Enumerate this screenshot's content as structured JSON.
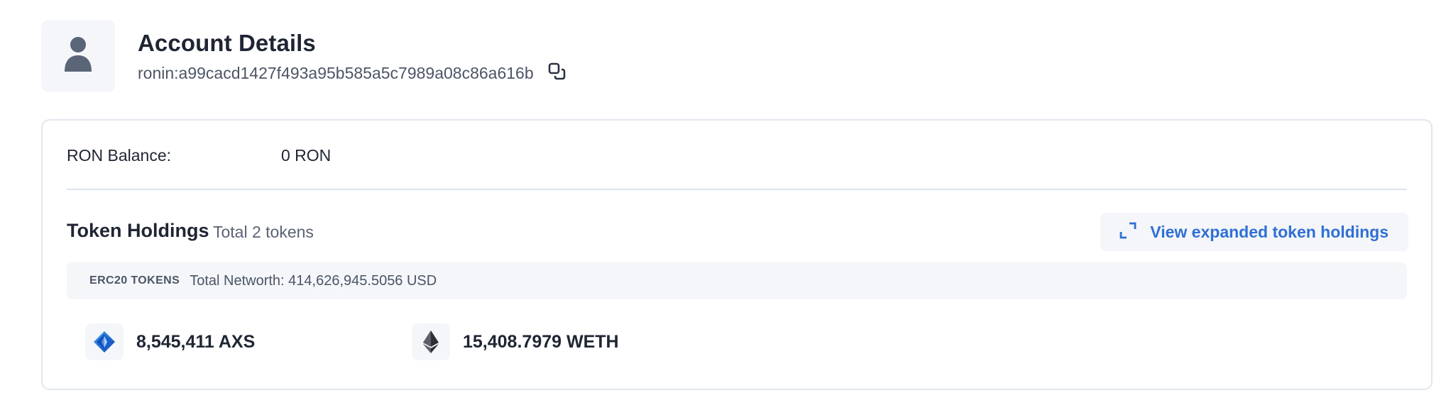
{
  "account": {
    "title": "Account Details",
    "address": "ronin:a99cacd1427f493a95b585a5c7989a08c86a616b",
    "avatar_icon": "user-icon",
    "copy_icon": "copy-icon"
  },
  "balance": {
    "label": "RON Balance:",
    "value": "0 RON"
  },
  "holdings": {
    "title": "Token Holdings",
    "total": "Total 2 tokens",
    "expand_label": "View expanded token holdings",
    "expand_icon": "expand-icon",
    "erc20": {
      "label": "ERC20 TOKENS",
      "networth": "Total Networth: 414,626,945.5056 USD"
    },
    "tokens": [
      {
        "amount": "8,545,411 AXS",
        "icon": "axs-icon"
      },
      {
        "amount": "15,408.7979 WETH",
        "icon": "eth-icon"
      }
    ]
  },
  "colors": {
    "accent": "#2f6fd6",
    "text": "#1f2533",
    "muted": "#4c5566",
    "panel": "#f4f6f9",
    "border": "#e2e7ef"
  }
}
